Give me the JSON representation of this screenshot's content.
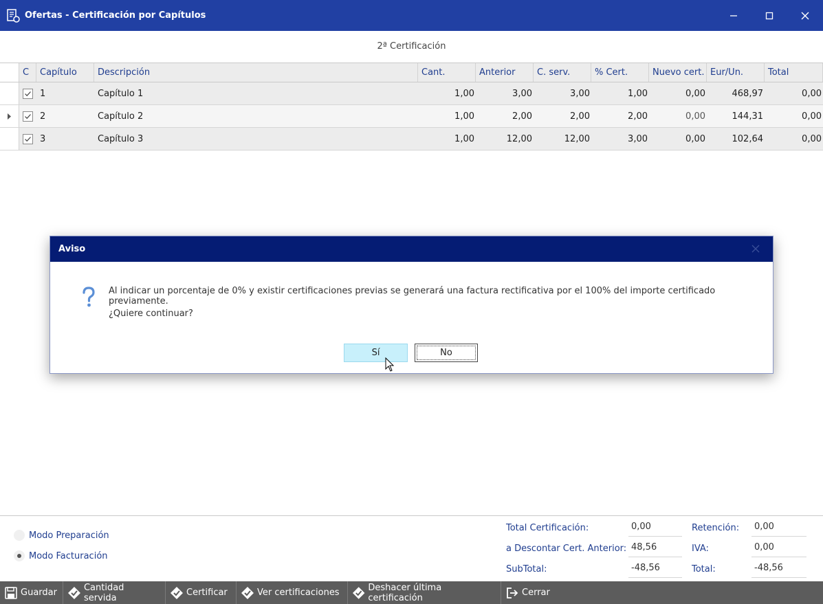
{
  "window": {
    "title": "Ofertas - Certificación por Capítulos",
    "subtitle": "2ª Certificación"
  },
  "grid": {
    "columns": [
      "C",
      "Capítulo",
      "Descripción",
      "Cant.",
      "Anterior",
      "C. serv.",
      "% Cert.",
      "Nuevo cert.",
      "Eur/Un.",
      "Total"
    ],
    "rows": [
      {
        "checked": true,
        "capitulo": "1",
        "descripcion": "Capítulo 1",
        "cant": "1,00",
        "anterior": "3,00",
        "cserv": "3,00",
        "pcert": "1,00",
        "nuevo": "0,00",
        "eur": "468,97",
        "total": "0,00"
      },
      {
        "checked": true,
        "capitulo": "2",
        "descripcion": "Capítulo 2",
        "cant": "1,00",
        "anterior": "2,00",
        "cserv": "2,00",
        "pcert": "2,00",
        "nuevo": "0,00",
        "eur": "144,31",
        "total": "0,00"
      },
      {
        "checked": true,
        "capitulo": "3",
        "descripcion": "Capítulo 3",
        "cant": "1,00",
        "anterior": "12,00",
        "cserv": "12,00",
        "pcert": "3,00",
        "nuevo": "0,00",
        "eur": "102,64",
        "total": "0,00"
      }
    ]
  },
  "dialog": {
    "title": "Aviso",
    "message": "Al indicar un porcentaje de 0% y existir certificaciones previas se generará una factura rectificativa por el 100% del importe certificado previamente.",
    "question": "¿Quiere continuar?",
    "yes_label": "Sí",
    "no_label": "No"
  },
  "modes": {
    "preparacion": "Modo Preparación",
    "facturacion": "Modo Facturación",
    "selected": "facturacion"
  },
  "totals": {
    "total_cert_label": "Total Certificación:",
    "total_cert": "0,00",
    "descontar_label": "a Descontar Cert. Anterior:",
    "descontar": "48,56",
    "subtotal_label": "SubTotal:",
    "subtotal": "-48,56",
    "retencion_label": "Retención:",
    "retencion": "0,00",
    "iva_label": "IVA:",
    "iva": "0,00",
    "total_label": "Total:",
    "total": "-48,56"
  },
  "toolbar": {
    "guardar": "Guardar",
    "cantidad": "Cantidad servida",
    "certificar": "Certificar",
    "ver": "Ver certificaciones",
    "deshacer": "Deshacer última certificación",
    "cerrar": "Cerrar"
  },
  "colors": {
    "titlebar": "#2140a3",
    "dialog_title": "#051c74",
    "toolbar": "#5c5c5c",
    "accent_text": "#1f3d8f"
  }
}
